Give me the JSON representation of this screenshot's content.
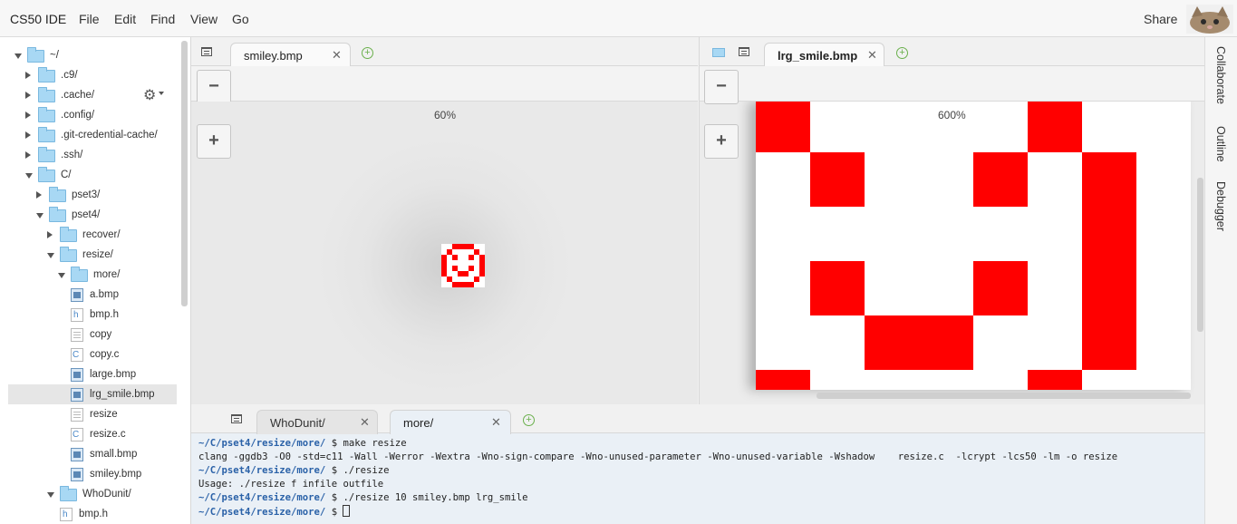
{
  "app": {
    "title": "CS50 IDE",
    "menu": [
      "File",
      "Edit",
      "Find",
      "View",
      "Go"
    ],
    "share_label": "Share"
  },
  "tree": {
    "items": [
      {
        "label": "~/",
        "kind": "folder",
        "state": "open",
        "depth": 0
      },
      {
        "label": ".c9/",
        "kind": "folder",
        "state": "closed",
        "depth": 1
      },
      {
        "label": ".cache/",
        "kind": "folder",
        "state": "closed",
        "depth": 1
      },
      {
        "label": ".config/",
        "kind": "folder",
        "state": "closed",
        "depth": 1
      },
      {
        "label": ".git-credential-cache/",
        "kind": "folder",
        "state": "closed",
        "depth": 1
      },
      {
        "label": ".ssh/",
        "kind": "folder",
        "state": "closed",
        "depth": 1
      },
      {
        "label": "C/",
        "kind": "folder",
        "state": "open",
        "depth": 1
      },
      {
        "label": "pset3/",
        "kind": "folder",
        "state": "closed",
        "depth": 2
      },
      {
        "label": "pset4/",
        "kind": "folder",
        "state": "open",
        "depth": 2
      },
      {
        "label": "recover/",
        "kind": "folder",
        "state": "closed",
        "depth": 3
      },
      {
        "label": "resize/",
        "kind": "folder",
        "state": "open",
        "depth": 3
      },
      {
        "label": "more/",
        "kind": "folder",
        "state": "open",
        "depth": 4
      },
      {
        "label": "a.bmp",
        "kind": "img",
        "depth": 5
      },
      {
        "label": "bmp.h",
        "kind": "h",
        "depth": 5
      },
      {
        "label": "copy",
        "kind": "txt",
        "depth": 5
      },
      {
        "label": "copy.c",
        "kind": "c",
        "depth": 5
      },
      {
        "label": "large.bmp",
        "kind": "img",
        "depth": 5
      },
      {
        "label": "lrg_smile.bmp",
        "kind": "img",
        "depth": 5,
        "selected": true
      },
      {
        "label": "resize",
        "kind": "txt",
        "depth": 5
      },
      {
        "label": "resize.c",
        "kind": "c",
        "depth": 5
      },
      {
        "label": "small.bmp",
        "kind": "img",
        "depth": 5
      },
      {
        "label": "smiley.bmp",
        "kind": "img",
        "depth": 5
      },
      {
        "label": "WhoDunit/",
        "kind": "folder",
        "state": "open",
        "depth": 3
      },
      {
        "label": "bmp.h",
        "kind": "h",
        "depth": 4
      }
    ]
  },
  "left_pane": {
    "tab_label": "smiley.bmp",
    "zoom_label": "60%",
    "zoom_out": "−",
    "zoom_in": "+"
  },
  "right_pane": {
    "tab_label": "lrg_smile.bmp",
    "zoom_label": "600%",
    "zoom_out": "−",
    "zoom_in": "+"
  },
  "side_panel": [
    "Collaborate",
    "Outline",
    "Debugger"
  ],
  "terminal": {
    "tabs": [
      "WhoDunit/",
      "more/"
    ],
    "lines": [
      {
        "prompt": "~/C/pset4/resize/more/",
        "text": " $ make resize"
      },
      {
        "prompt": "",
        "text": "clang -ggdb3 -O0 -std=c11 -Wall -Werror -Wextra -Wno-sign-compare -Wno-unused-parameter -Wno-unused-variable -Wshadow    resize.c  -lcrypt -lcs50 -lm -o resize"
      },
      {
        "prompt": "~/C/pset4/resize/more/",
        "text": " $ ./resize"
      },
      {
        "prompt": "",
        "text": "Usage: ./resize f infile outfile"
      },
      {
        "prompt": "~/C/pset4/resize/more/",
        "text": " $ ./resize 10 smiley.bmp lrg_smile"
      },
      {
        "prompt": "~/C/pset4/resize/more/",
        "text": " $ "
      }
    ]
  },
  "colors": {
    "image_red": "#ff0000",
    "prompt_blue": "#2b62a8",
    "terminal_bg": "#eaf0f6"
  }
}
